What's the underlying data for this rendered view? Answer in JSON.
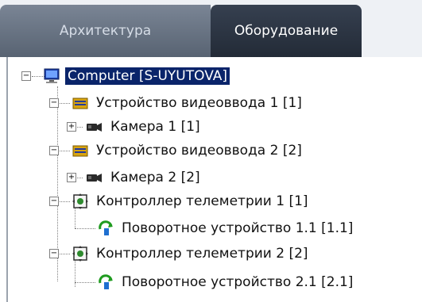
{
  "tabs": [
    {
      "label": "Архитектура"
    },
    {
      "label": "Оборудование"
    }
  ],
  "tree": {
    "root": {
      "label": "Computer [S-UYUTOVA]",
      "icon": "computer-icon"
    },
    "items": [
      {
        "label": "Устройство видеоввода 1 [1]",
        "icon": "video-capture-card-icon"
      },
      {
        "label": "Камера 1 [1]",
        "icon": "camera-icon"
      },
      {
        "label": "Устройство видеоввода 2 [2]",
        "icon": "video-capture-card-icon"
      },
      {
        "label": "Камера 2 [2]",
        "icon": "camera-icon"
      },
      {
        "label": "Контроллер телеметрии 1 [1]",
        "icon": "telemetry-controller-icon"
      },
      {
        "label": "Поворотное устройство 1.1 [1.1]",
        "icon": "ptz-device-icon"
      },
      {
        "label": "Контроллер телеметрии 2 [2]",
        "icon": "telemetry-controller-icon"
      },
      {
        "label": "Поворотное устройство 2.1 [2.1]",
        "icon": "ptz-device-icon"
      }
    ]
  }
}
